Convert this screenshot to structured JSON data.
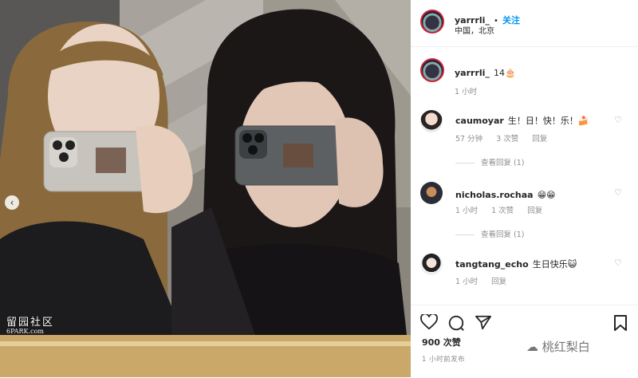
{
  "post_author": {
    "username": "yarrrli_",
    "separator": "•",
    "follow": "关注",
    "location": "中国，北京"
  },
  "caption": {
    "username": "yarrrli_",
    "text": "14🎂",
    "time": "1 小时"
  },
  "comments": [
    {
      "username": "caumoyar",
      "text": "生！日！快！乐！🍰",
      "time": "57 分钟",
      "likes": "3 次赞",
      "reply": "回复",
      "view_replies": "查看回复 (1)"
    },
    {
      "username": "nicholas.rochaa",
      "text": "😁😁",
      "time": "1 小时",
      "likes": "1 次赞",
      "reply": "回复",
      "view_replies": "查看回复 (1)"
    },
    {
      "username": "tangtang_echo",
      "text": "生日快乐😺",
      "time": "1 小时",
      "reply": "回复"
    }
  ],
  "likes_count": "900 次赞",
  "post_time": "1 小时前发布",
  "watermark": {
    "line1": "留园社区",
    "line2": "6PARK.com"
  },
  "wechat_watermark": "桃红梨白",
  "colors": {
    "link_blue": "#0095f6",
    "story_ring": "#c8233b",
    "gray_text": "#8e8e8e"
  }
}
